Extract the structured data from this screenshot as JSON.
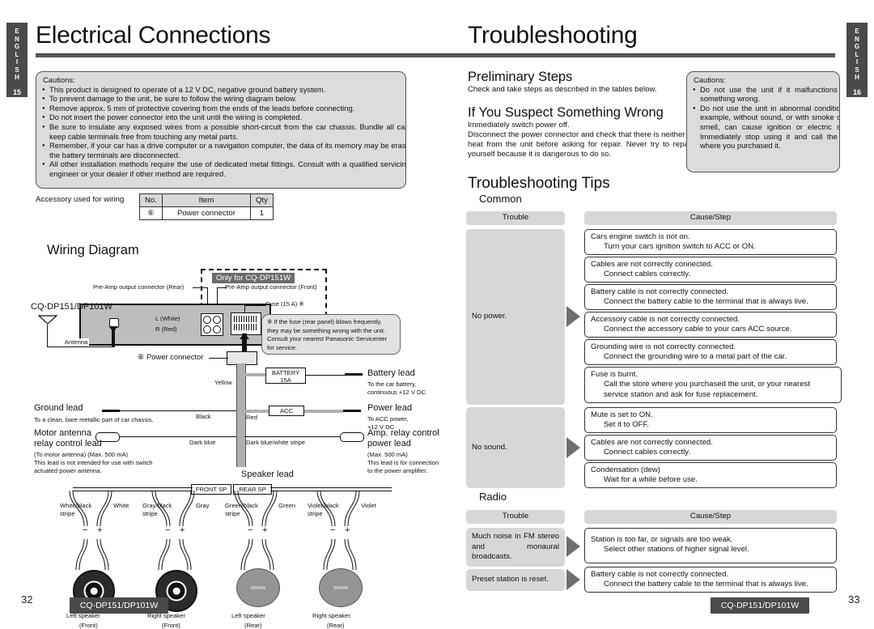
{
  "left_page": {
    "lang_tab": {
      "letters": [
        "E",
        "N",
        "G",
        "L",
        "I",
        "S",
        "H"
      ],
      "page": "15"
    },
    "title": "Electrical Connections",
    "cautions": {
      "heading": "Cautions:",
      "items": [
        "This product is designed to operate of a 12 V DC, negative ground battery system.",
        "To prevent damage to the unit, be sure to follow the wiring diagram below.",
        "Remove approx. 5 mm of protective covering from the ends of the leads before connecting.",
        "Do not insert the power connector into the unit until the wiring is completed.",
        "Be sure to insulate any exposed wires from a possible short-circuit from the car chassis. Bundle all cables and keep cable terminals free from touching any metal parts.",
        "Remember, if your car has a drive computer or a navigation computer, the data of its memory may be erased when the battery terminals are disconnected.",
        "All other installation methods require the use of dedicated metal fittings. Consult with a qualified servicing engineer or your dealer if other method are required."
      ]
    },
    "accessory": {
      "label": "Accessory used for wiring",
      "headers": [
        "No.",
        "Item",
        "Qty"
      ],
      "rows": [
        [
          "⑥",
          "Power connector",
          "1"
        ]
      ]
    },
    "wiring": {
      "heading": "Wiring Diagram",
      "only_for": "Only for CQ-DP151W",
      "preamp_rear": "Pre-Amp output connector (Rear)",
      "preamp_front": "Pre-Amp output connector (Front)",
      "model": "CQ-DP151/DP101W",
      "antenna": "Antenna",
      "l_white": "L (White)",
      "r_red": "R (Red)",
      "fuse": "Fuse (15 A) ※",
      "fuse_note": "※ If the fuse (rear panel) blows frequently, they may be something wrong with the unit. Consult your nearest Panasonic Servicenter for service.",
      "power_connector": "⑥ Power connector",
      "battery_box": "BATTERY\n15A",
      "battery_box_l1": "BATTERY",
      "battery_box_l2": "15A",
      "acc_box": "ACC",
      "yellow": "Yellow",
      "red": "Red",
      "black": "Black",
      "dark_blue": "Dark blue",
      "dark_blue_white": "Dark blue/white stripe",
      "battery_lead": "Battery lead",
      "battery_lead_sub": "To the car battery,\ncontinuous +12 V DC",
      "battery_lead_sub1": "To the car battery,",
      "battery_lead_sub2": "continuous +12 V DC",
      "power_lead": "Power lead",
      "power_lead_sub1": "To ACC power,",
      "power_lead_sub2": "+12 V DC",
      "ground_lead": "Ground lead",
      "ground_lead_sub": "To a clean, bare metallic part of car chassis.",
      "motor_antenna_l1": "Motor antenna",
      "motor_antenna_l2": "relay control lead",
      "motor_antenna_sub1": "(To motor antenna) (Max. 500 mA)",
      "motor_antenna_sub2": "This lead is not intended for use with switch",
      "motor_antenna_sub3": "actuated power antenna.",
      "amp_relay_l1": "Amp. relay control",
      "amp_relay_l2": "power lead",
      "amp_relay_sub1": "(Max. 500 mA)",
      "amp_relay_sub2": "This lead is for connection",
      "amp_relay_sub3": "to the power amplifier.",
      "speaker_lead": "Speaker lead",
      "front_sp": "FRONT SP",
      "rear_sp": "REAR SP",
      "speakers": [
        {
          "wire_minus_l1": "White/black",
          "wire_minus_l2": "stripe",
          "wire_plus": "White",
          "name": "Left speaker",
          "pos": "(Front)",
          "style": "front"
        },
        {
          "wire_minus_l1": "Gray/black",
          "wire_minus_l2": "stripe",
          "wire_plus": "Gray",
          "name": "Right speaker",
          "pos": "(Front)",
          "style": "front"
        },
        {
          "wire_minus_l1": "Green/black",
          "wire_minus_l2": "stripe",
          "wire_plus": "Green",
          "name": "Left speaker",
          "pos": "(Rear)",
          "style": "rear"
        },
        {
          "wire_minus_l1": "Violet/black",
          "wire_minus_l2": "stripe",
          "wire_plus": "Violet",
          "name": "Right speaker",
          "pos": "(Rear)",
          "style": "rear"
        }
      ],
      "minus": "−",
      "plus": "+"
    },
    "footer": {
      "page": "32",
      "model": "CQ-DP151/DP101W"
    }
  },
  "right_page": {
    "lang_tab": {
      "letters": [
        "E",
        "N",
        "G",
        "L",
        "I",
        "S",
        "H"
      ],
      "page": "16"
    },
    "title": "Troubleshooting",
    "preliminary": {
      "heading": "Preliminary Steps",
      "text": "Check and take steps as described in the tables below."
    },
    "suspect": {
      "heading": "If You Suspect Something Wrong",
      "line1": "Immediately switch power off.",
      "body": "Disconnect the power connector and check that there is neither smoke nor heat from the unit before asking for repair. Never try to repair the unit yourself because it is dangerous to do so."
    },
    "cautions": {
      "heading": "Cautions:",
      "items": [
        "Do not use the unit if it malfunctions or is something wrong.",
        "Do not use the unit in abnormal condition, for example, without sound, or with smoke or foul smell, can cause ignition or electric shock. Immediately stop using it and call the store where you purchased it."
      ]
    },
    "tips_heading": "Troubleshooting Tips",
    "tables": [
      {
        "section": "Common",
        "headers": [
          "Trouble",
          "Cause/Step"
        ],
        "groups": [
          {
            "trouble": "No power.",
            "causes": [
              {
                "cause": "Cars engine switch is not on.",
                "step": "Turn your cars ignition switch to ACC or ON."
              },
              {
                "cause": "Cables are not correctly connected.",
                "step": "Connect cables correctly."
              },
              {
                "cause": "Battery cable is not correctly connected.",
                "step": "Connect the battery cable to the terminal that is always live."
              },
              {
                "cause": "Accessory cable is not correctly connected.",
                "step": "Connect the accessory cable to your cars ACC source."
              },
              {
                "cause": "Grounding wire is not correctly connected.",
                "step": "Connect the grounding wire to a metal part of the car."
              },
              {
                "cause": "Fuse is burnt.",
                "step": "Call the store where you purchased the unit, or your nearest service station and ask for fuse replacement."
              }
            ]
          },
          {
            "trouble": "No sound.",
            "causes": [
              {
                "cause": "Mute is set to ON.",
                "step": "Set it to OFF."
              },
              {
                "cause": "Cables are not correctly connected.",
                "step": "Connect cables correctly."
              },
              {
                "cause": "Condensation (dew)",
                "step": "Wait for a while before use."
              }
            ]
          }
        ]
      },
      {
        "section": "Radio",
        "headers": [
          "Trouble",
          "Cause/Step"
        ],
        "groups": [
          {
            "trouble": "Much noise in FM stereo and monaural broadcasts.",
            "causes": [
              {
                "cause": "Station is too far, or signals are too weak.",
                "step": "Select other stations of higher signal level."
              }
            ]
          },
          {
            "trouble": "Preset station is reset.",
            "causes": [
              {
                "cause": "Battery cable is not correctly connected.",
                "step": "Connect the battery cable to the terminal that is always live."
              }
            ]
          }
        ]
      }
    ],
    "footer": {
      "page": "33",
      "model": "CQ-DP151/DP101W"
    }
  },
  "colors": {
    "tab_bg": "#4a4a4a",
    "rule": "#5b5b5b",
    "caution_bg": "#dcdcdc",
    "table_header_bg": "#d7d7d7",
    "arrow": "#6f6f6f",
    "unit_bg": "#bdbdbd"
  }
}
